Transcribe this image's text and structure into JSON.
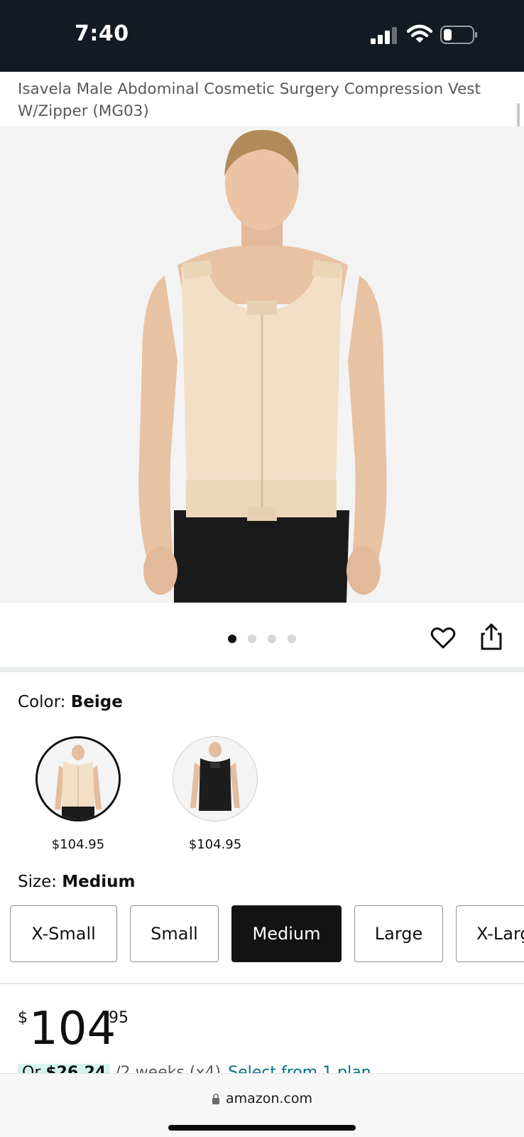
{
  "status_bar": {
    "time": "7:40",
    "icons": [
      "signal-icon",
      "wifi-icon",
      "battery-icon"
    ]
  },
  "product": {
    "title": "Isavela Male Abdominal Cosmetic Surgery Compression Vest W/Zipper (MG03)",
    "image_count": 4,
    "active_image_index": 0
  },
  "actions": {
    "wishlist_icon": "heart-icon",
    "share_icon": "share-icon"
  },
  "color": {
    "label": "Color: ",
    "selected": "Beige",
    "options": [
      {
        "name": "Beige",
        "price": "$104.95",
        "swatch_color": "#f0dcc4"
      },
      {
        "name": "Black",
        "price": "$104.95",
        "swatch_color": "#1b1b1b"
      }
    ]
  },
  "size": {
    "label": "Size: ",
    "selected": "Medium",
    "options": [
      "X-Small",
      "Small",
      "Medium",
      "Large",
      "X-Large"
    ]
  },
  "price": {
    "symbol": "$",
    "whole": "104",
    "fraction": "95"
  },
  "installments": {
    "prefix": "Or ",
    "amount": "$26.24",
    "terms": " /2 weeks (x4)",
    "link": "Select from 1 plan"
  },
  "browser": {
    "url": "amazon.com"
  },
  "colors": {
    "status_bar_bg": "#131a22",
    "link": "#007185",
    "selected_size_bg": "#131313",
    "installment_highlight": "#d7f2ee"
  }
}
